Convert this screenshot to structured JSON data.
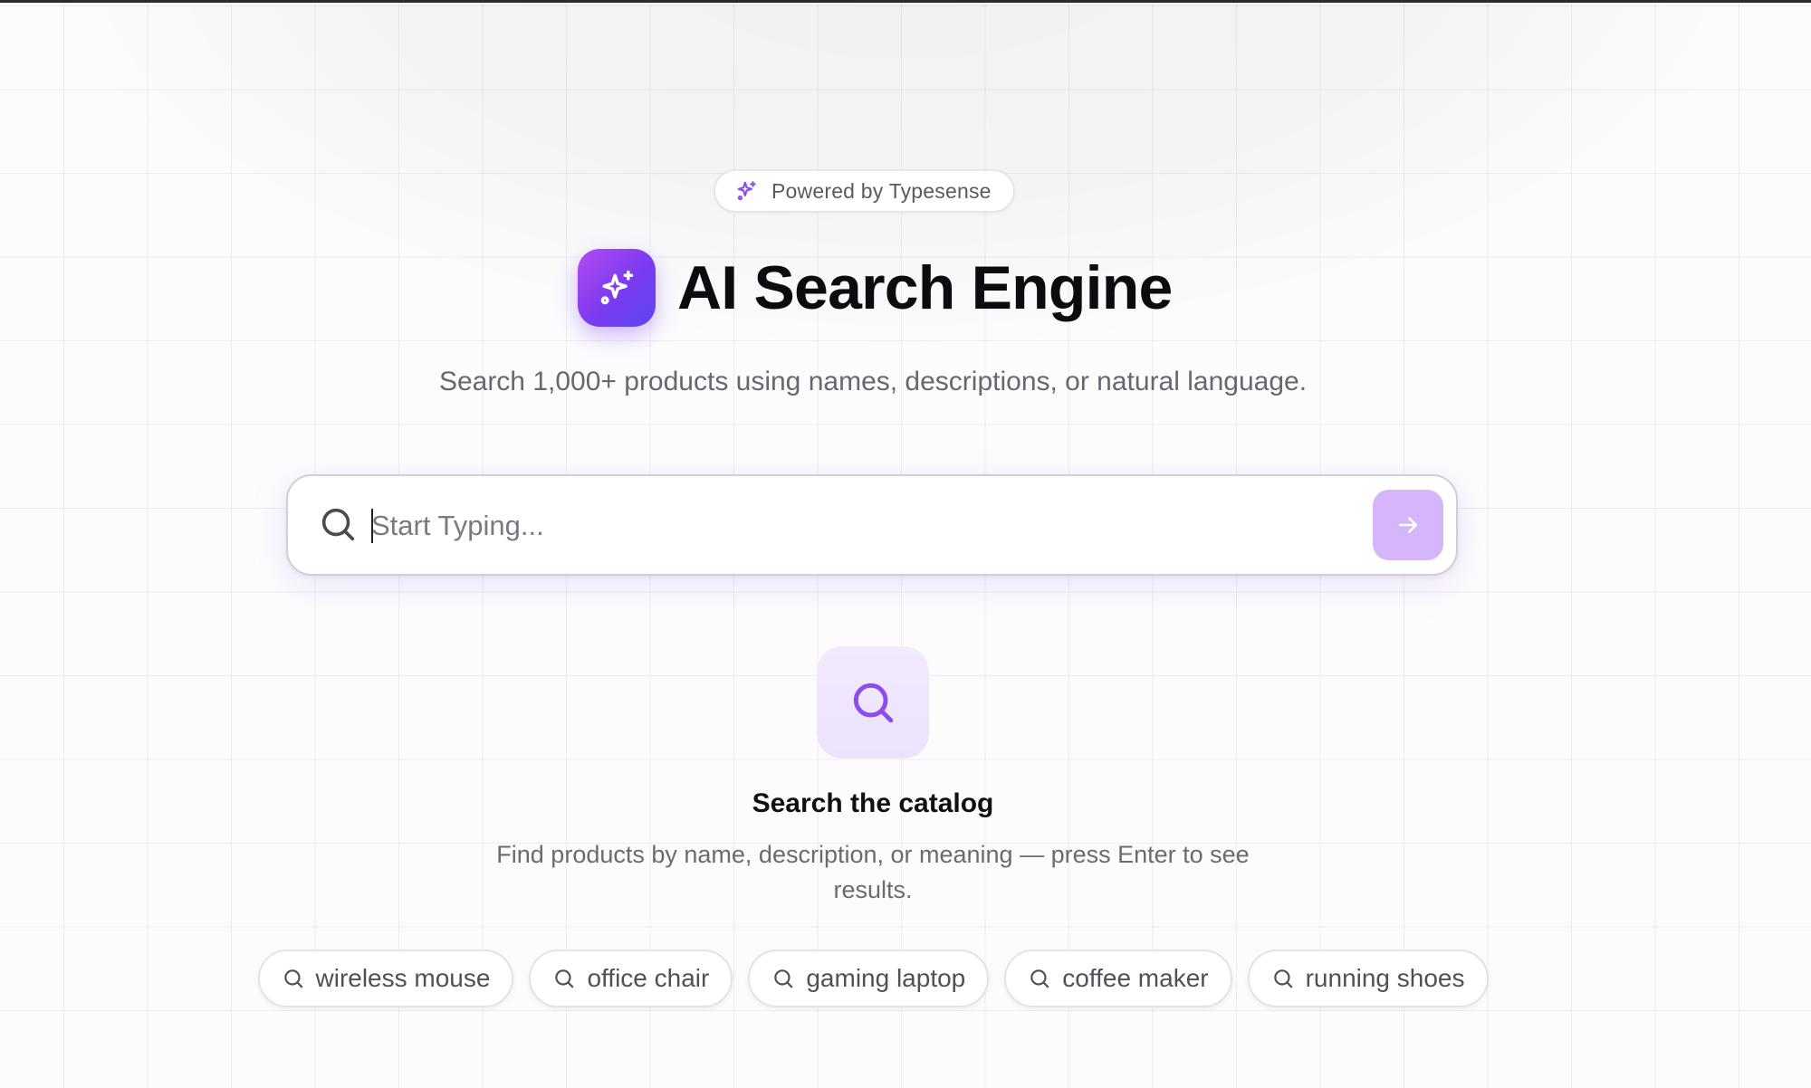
{
  "badge": {
    "icon": "sparkles-icon",
    "text": "Powered by Typesense"
  },
  "header": {
    "logo_icon": "sparkles-icon",
    "title": "AI Search Engine",
    "subtitle": "Search 1,000+ products using names, descriptions, or natural language."
  },
  "search": {
    "icon": "search-icon",
    "value": "",
    "placeholder": "Start Typing...",
    "submit_icon": "arrow-right-icon"
  },
  "empty_state": {
    "icon": "search-icon",
    "title": "Search the catalog",
    "description": "Find products by name, description, or meaning — press Enter to see results."
  },
  "suggestions": [
    {
      "label": "wireless mouse",
      "icon": "search-icon"
    },
    {
      "label": "office chair",
      "icon": "search-icon"
    },
    {
      "label": "gaming laptop",
      "icon": "search-icon"
    },
    {
      "label": "coffee maker",
      "icon": "search-icon"
    },
    {
      "label": "running shoes",
      "icon": "search-icon"
    }
  ],
  "colors": {
    "accent": "#7a3cf0",
    "accent_light": "#d6b6fb",
    "text_primary": "#0b0b10",
    "text_secondary": "#676770"
  }
}
